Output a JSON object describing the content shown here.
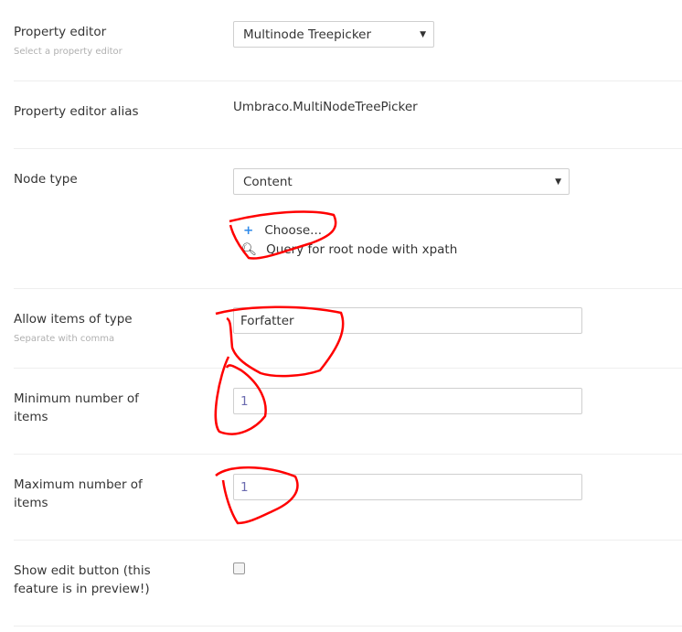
{
  "property_editor": {
    "label": "Property editor",
    "hint": "Select a property editor",
    "value": "Multinode Treepicker"
  },
  "alias": {
    "label": "Property editor alias",
    "value": "Umbraco.MultiNodeTreePicker"
  },
  "node_type": {
    "label": "Node type",
    "value": "Content",
    "choose": "Choose...",
    "query": "Query for root node with xpath"
  },
  "allow_items": {
    "label": "Allow items of type",
    "hint": "Separate with comma",
    "value": "Forfatter"
  },
  "min_items": {
    "label": "Minimum number of items",
    "value": "1"
  },
  "max_items": {
    "label": "Maximum number of items",
    "value": "1"
  },
  "show_edit": {
    "label": "Show edit button (this feature is in preview!)",
    "checked": false
  },
  "colors": {
    "accent": "#2e8aea",
    "annotation": "#ff0000"
  }
}
